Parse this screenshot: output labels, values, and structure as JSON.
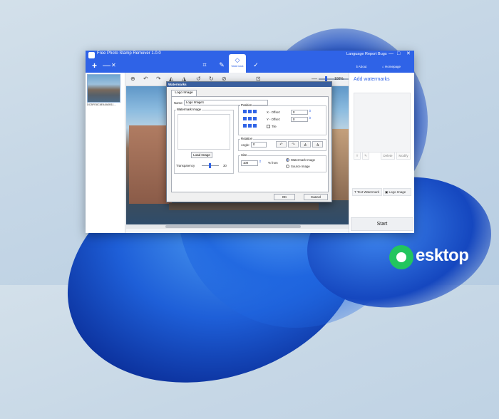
{
  "app": {
    "title": "Free Photo Stamp Remover 1.0.0",
    "plus_label": "+",
    "minus_label": "—",
    "close_label": "✕",
    "language_label": "Language  Report Bugs",
    "win_min": "—",
    "win_max": "□",
    "win_close": "✕",
    "about_label": "About",
    "homepage_label": "Homepage",
    "active_tool_label": "Watermark"
  },
  "thumbnail": {
    "caption": "DCBFE8C8E48A0B11..."
  },
  "toolbar": {
    "zoom": "100%",
    "minus": "—",
    "plus": "+"
  },
  "right_panel": {
    "title": "Add watermarks",
    "buttons": [
      "T",
      "✎",
      "Delete",
      "Modify"
    ],
    "text_watermark": "Text Watermark",
    "logo_image": "Logo Image",
    "start": "Start"
  },
  "dialog": {
    "title": "Watermarks",
    "tab": "Logo Image",
    "name_label": "Name:",
    "name_value": "Logo Image1",
    "watermark_image_group": "Watermark Image",
    "load_image": "Load Image",
    "transparency_label": "Transparency",
    "transparency_value": "30",
    "position_group": "Position",
    "x_offset_label": "X - Offset:",
    "x_offset_value": "0",
    "y_offset_label": "Y - Offset:",
    "y_offset_value": "0",
    "tile_label": "Tile",
    "rotation_group": "Rotation",
    "angle_label": "Angle:",
    "angle_value": "0",
    "size_group": "Size",
    "size_value": "100",
    "percent_from": "% from",
    "opt_watermark": "Watermark Image",
    "opt_source": "Source Image",
    "ok": "OK",
    "cancel": "Cancel"
  },
  "brand": {
    "text": "esktop",
    "color": "#22c55e"
  }
}
